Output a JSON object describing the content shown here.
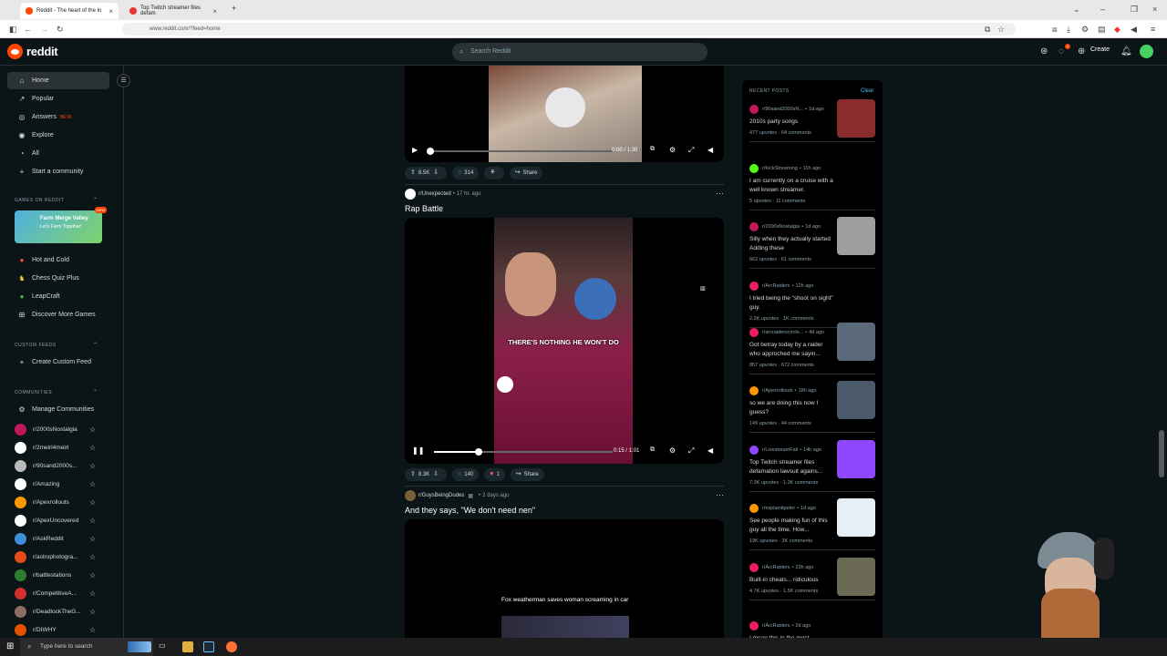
{
  "browser": {
    "tabs": [
      {
        "title": "Reddit - The heart of the in"
      },
      {
        "title": "Top Twitch streamer files defam"
      }
    ],
    "url": "www.reddit.com/?feed=home"
  },
  "header": {
    "logo_text": "reddit",
    "search_placeholder": "Search Reddit",
    "create_label": "Create",
    "chat_badge": "1"
  },
  "sidebar": {
    "nav": [
      {
        "label": "Home",
        "icon": "home-icon",
        "active": true
      },
      {
        "label": "Popular",
        "icon": "popular-icon"
      },
      {
        "label": "Answers",
        "icon": "answers-icon",
        "badge": "BETA"
      },
      {
        "label": "Explore",
        "icon": "explore-icon"
      },
      {
        "label": "All",
        "icon": "all-icon"
      },
      {
        "label": "Start a community",
        "icon": "plus-icon"
      }
    ],
    "games_heading": "GAMES ON REDDIT",
    "game_banner": {
      "title": "Farm Merge Valley",
      "subtitle": "Let's Farm Together!",
      "badge": "NEW"
    },
    "games": [
      {
        "label": "Hot and Cold"
      },
      {
        "label": "Chess Quiz Plus"
      },
      {
        "label": "LeapCraft"
      },
      {
        "label": "Discover More Games"
      }
    ],
    "custom_feeds_heading": "CUSTOM FEEDS",
    "create_custom_feed": "Create Custom Feed",
    "communities_heading": "COMMUNITIES",
    "manage_communities": "Manage Communities",
    "communities": [
      {
        "name": "r/2000sNostalgia",
        "color": "#c2185b"
      },
      {
        "name": "r/2meirl4meirl",
        "color": "#ffffff"
      },
      {
        "name": "r/90sand2000s...",
        "color": "#bbbbbb"
      },
      {
        "name": "r/Amazing",
        "color": "#ffffff"
      },
      {
        "name": "r/Apexrollouts",
        "color": "#ff9800"
      },
      {
        "name": "r/ApexUncovered",
        "color": "#ffffff"
      },
      {
        "name": "r/AskReddit",
        "color": "#3f8fd8"
      },
      {
        "name": "r/astrophotogra...",
        "color": "#e64a19"
      },
      {
        "name": "r/battlestations",
        "color": "#2e7d32"
      },
      {
        "name": "r/CompetitiveA...",
        "color": "#d32f2f"
      },
      {
        "name": "r/DeadlockTheG...",
        "color": "#8d6e63"
      },
      {
        "name": "r/DIWHY",
        "color": "#e65100"
      }
    ]
  },
  "feed": {
    "post1": {
      "time": "0:00 / 1:30",
      "votes": "8.5K",
      "comments": "314",
      "share": "Share",
      "video_progress": 0
    },
    "post2": {
      "subreddit": "r/Unexpected",
      "age": "17 hr. ago",
      "title": "Rap Battle",
      "caption": "THERE'S NOTHING HE WON'T DO",
      "time": "0:15 / 1:01",
      "votes": "8.3K",
      "comments": "140",
      "awards": "1",
      "share": "Share",
      "video_progress": 0.25
    },
    "post3": {
      "subreddit": "r/GuysBeingDudes",
      "age": "2 days ago",
      "title": "And they says, \"We don't need nen\"",
      "caption": "Fox weatherman saves woman screaming in car"
    }
  },
  "recent": {
    "heading": "RECENT POSTS",
    "clear": "Clear",
    "posts": [
      {
        "sub": "r/90sand2000sN...",
        "age": "1d ago",
        "title": "2010s party songs",
        "stats": "477 upvotes · 64 comments",
        "color": "#c2185b",
        "thumb": "#8b2c2c"
      },
      {
        "sub": "r/KickStreaming",
        "age": "11h ago",
        "title": "I am currently on a cruise with a well known streamer.",
        "stats": "5 upvotes · 11 comments",
        "color": "#53fc18",
        "thumb": ""
      },
      {
        "sub": "r/2000sNostalgia",
        "age": "1d ago",
        "title": "Silly when they actually started Adding these",
        "stats": "662 upvotes · 61 comments",
        "color": "#c2185b",
        "thumb": "#9e9e9e"
      },
      {
        "sub": "r/ArcRaiders",
        "age": "12h ago",
        "title": "I tried being the \"shoot on sight\" guy.",
        "stats": "2.2K upvotes · 1K comments",
        "color": "#e91e63",
        "thumb": ""
      },
      {
        "sub": "r/arcraiderscircle...",
        "age": "4d ago",
        "title": "Got betray today by a raider who approched me sayin...",
        "stats": "857 upvotes · 672 comments",
        "color": "#e91e63",
        "thumb": "#5b6a7a"
      },
      {
        "sub": "r/Apexrollouts",
        "age": "18h ago",
        "title": "so we are doing this now I guess?",
        "stats": "149 upvotes · 44 comments",
        "color": "#ff9800",
        "thumb": "#4a5a6a"
      },
      {
        "sub": "r/LivestreamFail",
        "age": "14h ago",
        "title": "Top Twitch streamer files defamation lawsuit agains...",
        "stats": "7.3K upvotes · 1.3K comments",
        "color": "#9146ff",
        "thumb": "#9146ff"
      },
      {
        "sub": "r/explainitpeter",
        "age": "1d ago",
        "title": "See people making fun of this guy all the time. How...",
        "stats": "19K upvotes · 3K comments",
        "color": "#ff9800",
        "thumb": "#e8eef5"
      },
      {
        "sub": "r/ArcRaiders",
        "age": "23h ago",
        "title": "Built-in cheats... ridiculous",
        "stats": "4.7K upvotes · 1.5K comments",
        "color": "#e91e63",
        "thumb": "#6b6b55"
      },
      {
        "sub": "r/ArcRaiders",
        "age": "2d ago",
        "title": "I mean this in the most respectful way",
        "stats": "",
        "color": "#e91e63",
        "thumb": ""
      }
    ]
  },
  "taskbar": {
    "search_placeholder": "Type here to search"
  }
}
